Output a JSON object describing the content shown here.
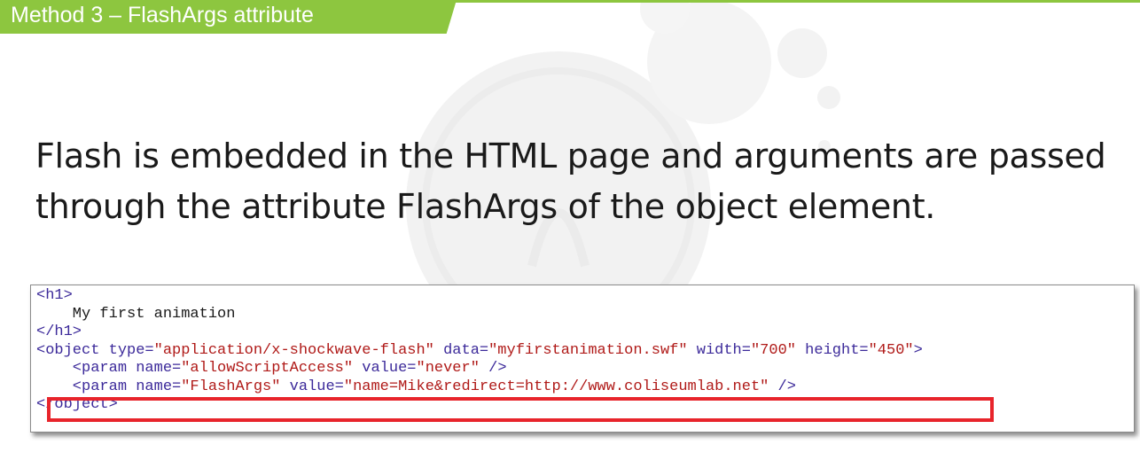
{
  "slide": {
    "title": "Method 3 – FlashArgs attribute",
    "body_lines": [
      "Flash is embedded in the HTML page and arguments are passed",
      "through the attribute FlashArgs of the object element."
    ]
  },
  "code": {
    "lines": [
      [
        {
          "t": "<h1>",
          "c": "tag"
        }
      ],
      [
        {
          "t": "    My first animation",
          "c": "txt"
        }
      ],
      [
        {
          "t": "</h1>",
          "c": "tag"
        }
      ],
      [
        {
          "t": "<object type=",
          "c": "tag"
        },
        {
          "t": "\"application/x-shockwave-flash\"",
          "c": "val"
        },
        {
          "t": " data=",
          "c": "tag"
        },
        {
          "t": "\"myfirstanimation.swf\"",
          "c": "val"
        },
        {
          "t": " width=",
          "c": "tag"
        },
        {
          "t": "\"700\"",
          "c": "val"
        },
        {
          "t": " height=",
          "c": "tag"
        },
        {
          "t": "\"450\"",
          "c": "val"
        },
        {
          "t": ">",
          "c": "tag"
        }
      ],
      [
        {
          "t": "    <param name=",
          "c": "tag"
        },
        {
          "t": "\"allowScriptAccess\"",
          "c": "val"
        },
        {
          "t": " value=",
          "c": "tag"
        },
        {
          "t": "\"never\"",
          "c": "val"
        },
        {
          "t": " />",
          "c": "tag"
        }
      ],
      [
        {
          "t": "    <param name=",
          "c": "tag"
        },
        {
          "t": "\"FlashArgs\"",
          "c": "val"
        },
        {
          "t": " value=",
          "c": "tag"
        },
        {
          "t": "\"name=Mike&redirect=http://www.coliseumlab.net\"",
          "c": "val"
        },
        {
          "t": " />",
          "c": "tag"
        }
      ],
      [
        {
          "t": "</object>",
          "c": "tag"
        }
      ]
    ],
    "highlighted_line_index": 5
  },
  "colors": {
    "accent_green": "#8dc63f",
    "highlight_red": "#e8242b",
    "code_tag": "#3c2a9a",
    "code_value": "#b01a18"
  }
}
